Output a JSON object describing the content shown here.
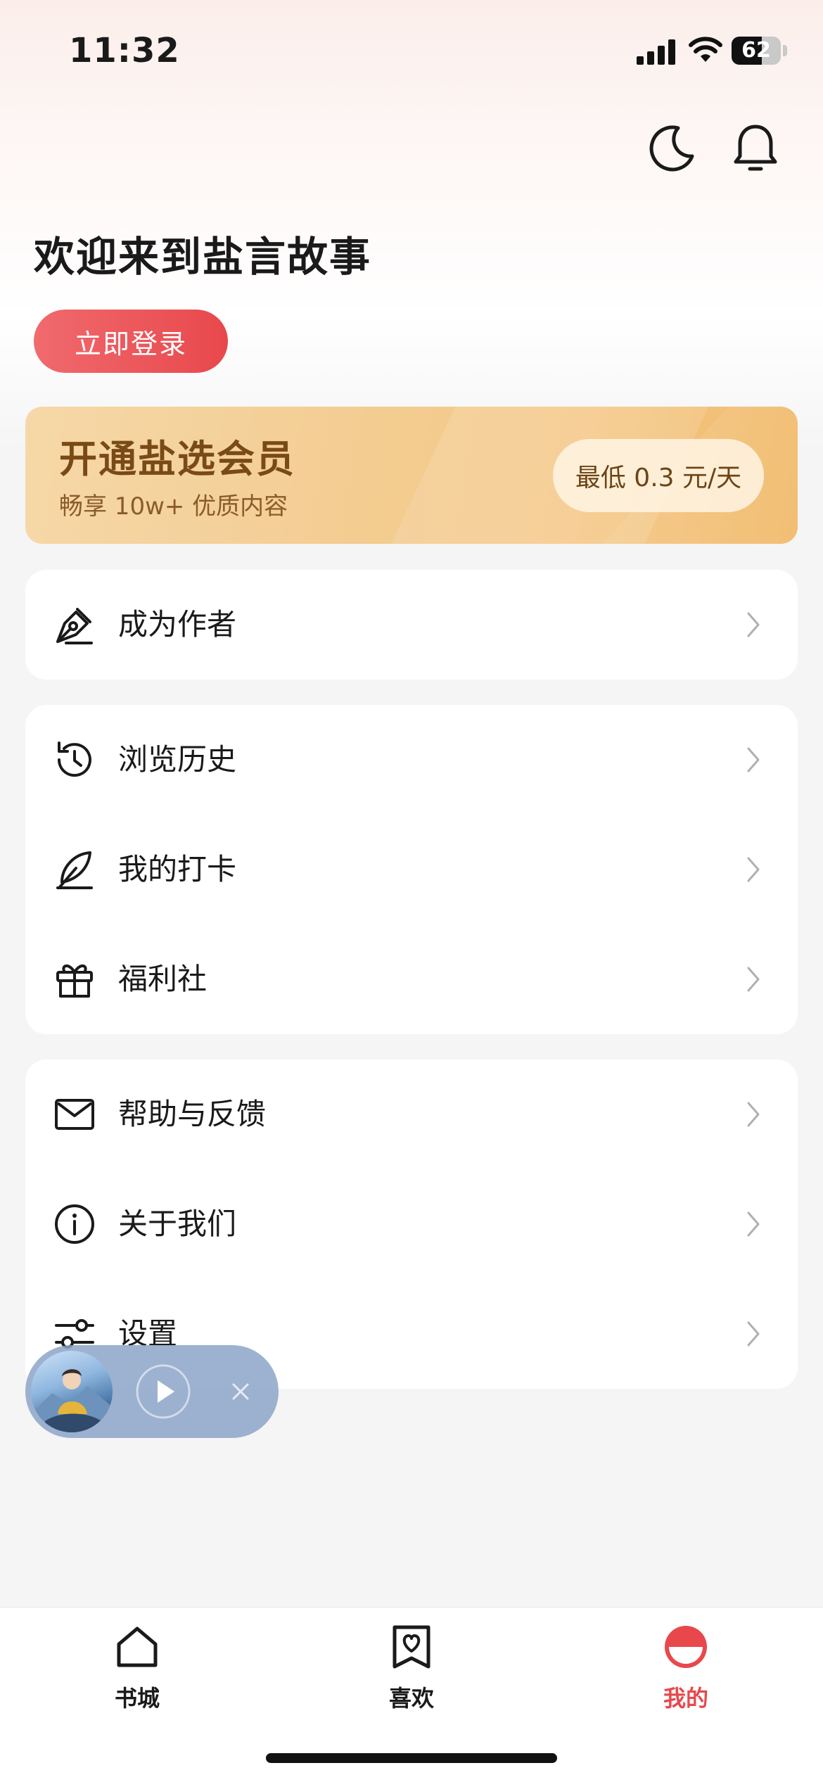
{
  "status_bar": {
    "time": "11:32",
    "battery": "62",
    "battery_level": 0.62
  },
  "header": {
    "night_mode_icon": "moon-icon",
    "notification_icon": "bell-icon",
    "welcome_title": "欢迎来到盐言故事",
    "login_button": "立即登录"
  },
  "vip_banner": {
    "title": "开通盐选会员",
    "subtitle": "畅享 10w+ 优质内容",
    "price_button": "最低 0.3 元/天"
  },
  "menu_groups": [
    {
      "items": [
        {
          "label": "成为作者",
          "icon": "pen-nib-icon"
        }
      ]
    },
    {
      "items": [
        {
          "label": "浏览历史",
          "icon": "history-icon"
        },
        {
          "label": "我的打卡",
          "icon": "feather-icon"
        },
        {
          "label": "福利社",
          "icon": "gift-icon"
        }
      ]
    },
    {
      "items": [
        {
          "label": "帮助与反馈",
          "icon": "mail-icon"
        },
        {
          "label": "关于我们",
          "icon": "info-icon"
        },
        {
          "label": "设置",
          "icon": "settings-sliders-icon"
        }
      ]
    }
  ],
  "mini_player": {
    "play_icon": "play-icon",
    "close_icon": "close-icon"
  },
  "tab_bar": {
    "tabs": [
      {
        "label": "书城",
        "icon": "home-icon",
        "active": false
      },
      {
        "label": "喜欢",
        "icon": "heart-bookmark-icon",
        "active": false
      },
      {
        "label": "我的",
        "icon": "profile-icon",
        "active": true
      }
    ]
  },
  "colors": {
    "accent": "#e8484c",
    "vip_gold": "#f3cc91",
    "vip_text": "#7a4a16",
    "background": "#f5f5f6"
  }
}
